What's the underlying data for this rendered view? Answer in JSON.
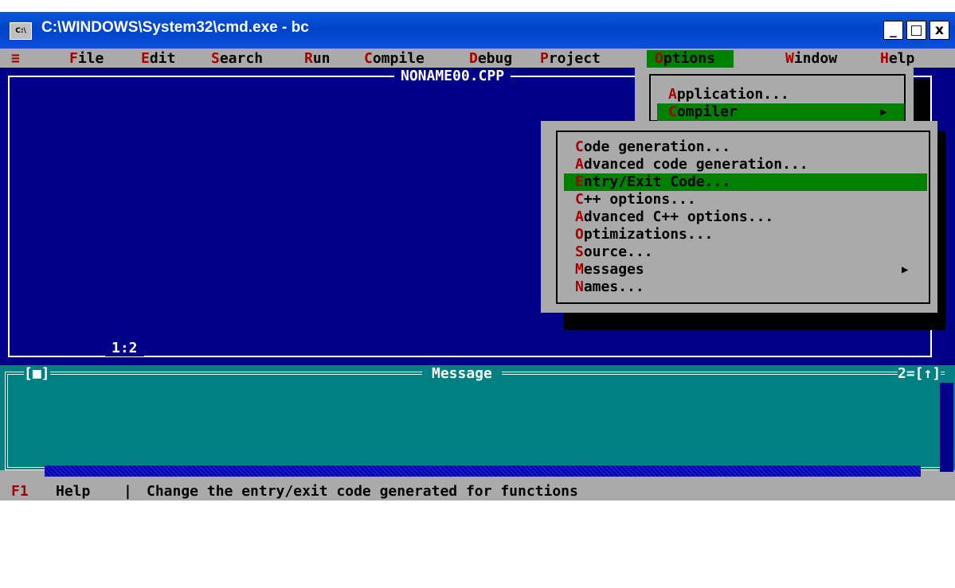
{
  "window": {
    "title": "C:\\WINDOWS\\System32\\cmd.exe - bc",
    "icon": "cmd-icon",
    "buttons": {
      "minimize": "_",
      "maximize": "□",
      "close": "x"
    }
  },
  "menubar": {
    "system": "≡",
    "items": [
      {
        "hot": "F",
        "rest": "ile"
      },
      {
        "hot": "E",
        "rest": "dit"
      },
      {
        "hot": "S",
        "rest": "earch"
      },
      {
        "hot": "R",
        "rest": "un"
      },
      {
        "hot": "C",
        "rest": "ompile"
      },
      {
        "hot": "D",
        "rest": "ebug"
      },
      {
        "hot": "P",
        "rest": "roject"
      },
      {
        "hot": "O",
        "rest": "ptions"
      },
      {
        "hot": "W",
        "rest": "indow"
      },
      {
        "hot": "H",
        "rest": "elp"
      }
    ]
  },
  "editor": {
    "filename": "NONAME00.CPP",
    "cursor_pos": "1:2"
  },
  "options_menu": {
    "items": [
      {
        "hot": "A",
        "rest": "pplication..."
      },
      {
        "hot": "C",
        "rest": "ompiler",
        "arrow": "▶"
      }
    ]
  },
  "compiler_menu": {
    "items": [
      {
        "hot": "C",
        "rest": "ode generation..."
      },
      {
        "hot": "A",
        "rest": "dvanced code generation..."
      },
      {
        "hot": "E",
        "rest": "ntry/Exit Code..."
      },
      {
        "hot": "C",
        "rest": "++ options..."
      },
      {
        "hot": "A",
        "rest": "dvanced C++ options..."
      },
      {
        "hot": "O",
        "rest": "ptimizations..."
      },
      {
        "hot": "S",
        "rest": "ource..."
      },
      {
        "hot": "M",
        "rest": "essages",
        "arrow": "▶"
      },
      {
        "hot": "N",
        "rest": "ames..."
      }
    ]
  },
  "message_window": {
    "title": "Message",
    "close": "[■]",
    "number": "2=[↑]"
  },
  "statusbar": {
    "key": "F1",
    "key_label": "Help",
    "separator": "|",
    "hint": "Change the entry/exit code generated for functions"
  },
  "colors": {
    "editor_bg": "#000088",
    "message_bg": "#008080",
    "menu_bg": "#aaaaaa",
    "selected": "#008000",
    "hotkey": "#a80000"
  }
}
